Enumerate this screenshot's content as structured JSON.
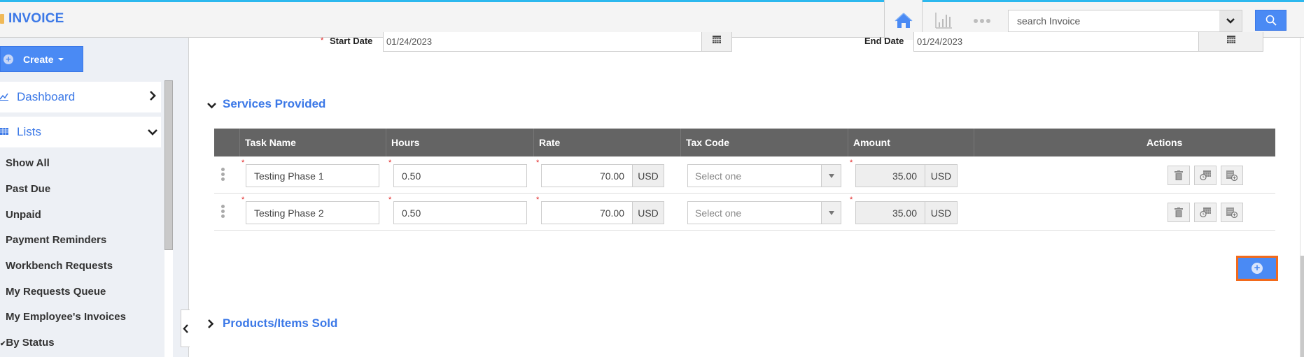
{
  "header": {
    "app_title": "INVOICE",
    "search": {
      "placeholder": "search Invoice",
      "value": ""
    },
    "icons": {
      "home": "home-icon",
      "reports": "bar-chart-icon",
      "more": "more-dots-icon",
      "search_dropdown": "chevron-down-icon",
      "search": "search-icon"
    },
    "colors": {
      "accent": "#3b78e7",
      "button": "#4a8af4",
      "top_bar": "#2cb8ee"
    }
  },
  "sidebar": {
    "create_label": "Create",
    "nav": [
      {
        "label": "Dashboard",
        "icon": "line-chart-icon",
        "state": "collapsed"
      },
      {
        "label": "Lists",
        "icon": "grid-icon",
        "state": "expanded"
      }
    ],
    "links": [
      "Show All",
      "Past Due",
      "Unpaid",
      "Payment Reminders",
      "Workbench Requests",
      "My Requests Queue",
      "My Employee's Invoices",
      "By Status"
    ]
  },
  "form": {
    "start_date": {
      "label": "Start Date",
      "required": "*",
      "value": "01/24/2023"
    },
    "end_date": {
      "label": "End Date",
      "value": "01/24/2023"
    }
  },
  "services": {
    "title": "Services Provided",
    "columns": [
      "Task Name",
      "Hours",
      "Rate",
      "Tax Code",
      "Amount",
      "",
      "Actions"
    ],
    "rows": [
      {
        "task": "Testing Phase 1",
        "hours": "0.50",
        "rate": "70.00",
        "rate_currency": "USD",
        "tax_code": "Select one",
        "amount": "35.00",
        "amount_currency": "USD"
      },
      {
        "task": "Testing Phase 2",
        "hours": "0.50",
        "rate": "70.00",
        "rate_currency": "USD",
        "tax_code": "Select one",
        "amount": "35.00",
        "amount_currency": "USD"
      }
    ],
    "required_mark": "*",
    "actions": [
      "delete-icon",
      "schedule-icon",
      "add-detail-icon"
    ],
    "add_row_highlight": "#f26a1b"
  },
  "products": {
    "title": "Products/Items Sold"
  }
}
